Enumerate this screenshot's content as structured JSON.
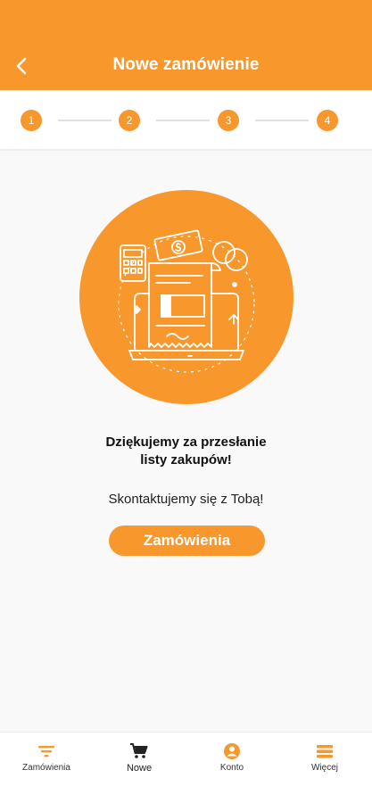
{
  "header": {
    "title": "Nowe zamówienie"
  },
  "stepper": {
    "steps": [
      "1",
      "2",
      "3",
      "4"
    ]
  },
  "confirmation": {
    "thanks_line1": "Dziękujemy za przesłanie",
    "thanks_line2": "listy zakupów!",
    "contact_text": "Skontaktujemy się z Tobą!",
    "orders_button_label": "Zamówienia"
  },
  "tabbar": {
    "items": [
      {
        "label": "Zamówienia",
        "icon": "filter-icon"
      },
      {
        "label": "Nowe",
        "icon": "cart-icon"
      },
      {
        "label": "Konto",
        "icon": "account-icon"
      },
      {
        "label": "Więcej",
        "icon": "menu-icon"
      }
    ]
  },
  "colors": {
    "accent": "#f7972c",
    "background": "#f9f9f9"
  }
}
